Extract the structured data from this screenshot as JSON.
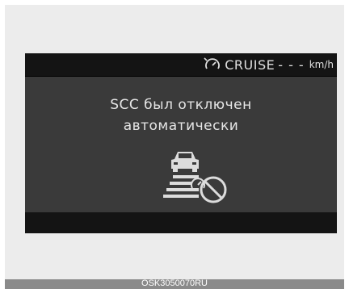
{
  "header": {
    "cruise_label": "CRUISE",
    "speed_value": "- - -",
    "speed_unit": "km/h",
    "cruise_icon": "cruise-speedometer-icon"
  },
  "message": {
    "line1": "SCC был отключен",
    "line2": "автоматически"
  },
  "warning_icon": "scc-cancelled-icon",
  "figure_code": "OSK3050070RU",
  "colors": {
    "screen_bg": "#3a3a3a",
    "bar_bg": "#141414",
    "text": "#e6e6e6",
    "caption_bar": "#8a8a8a"
  }
}
